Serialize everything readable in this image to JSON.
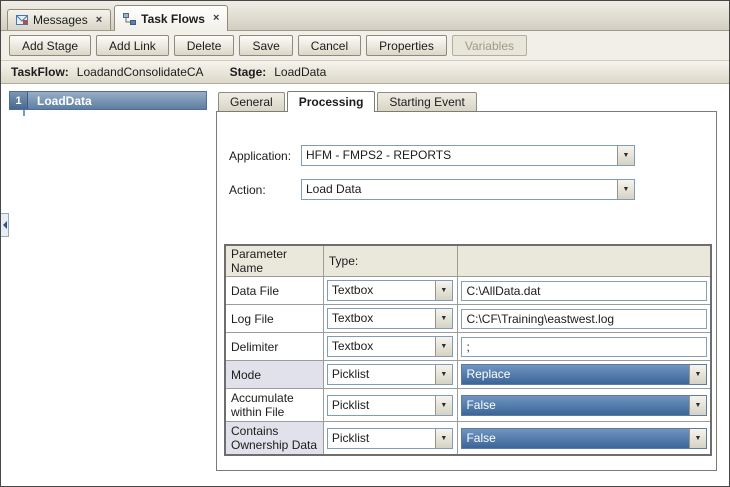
{
  "doc_tabs": [
    {
      "label": "Messages"
    },
    {
      "label": "Task Flows"
    }
  ],
  "icons": {
    "close": "×",
    "chevron_down": "▼"
  },
  "toolbar": {
    "buttons": [
      {
        "label": "Add Stage"
      },
      {
        "label": "Add Link"
      },
      {
        "label": "Delete"
      },
      {
        "label": "Save"
      },
      {
        "label": "Cancel"
      },
      {
        "label": "Properties"
      },
      {
        "label": "Variables",
        "disabled": true
      }
    ]
  },
  "info_bar": {
    "taskflow_label": "TaskFlow:",
    "taskflow_value": "LoadandConsolidateCA",
    "stage_label": "Stage:",
    "stage_value": "LoadData"
  },
  "stage": {
    "number": "1",
    "name": "LoadData"
  },
  "detail_tabs": [
    {
      "label": "General"
    },
    {
      "label": "Processing",
      "active": true
    },
    {
      "label": "Starting Event"
    }
  ],
  "form": {
    "application_label": "Application:",
    "application_value": "HFM - FMPS2 - REPORTS",
    "action_label": "Action:",
    "action_value": "Load Data"
  },
  "param_table": {
    "headers": [
      "Parameter Name",
      "Type:",
      ""
    ],
    "rows": [
      {
        "name": "Data File",
        "type": "Textbox",
        "value": "C:\\AllData.dat",
        "kind": "textbox",
        "shaded": false
      },
      {
        "name": "Log File",
        "type": "Textbox",
        "value": "C:\\CF\\Training\\eastwest.log",
        "kind": "textbox",
        "shaded": false
      },
      {
        "name": "Delimiter",
        "type": "Textbox",
        "value": ";",
        "kind": "textbox",
        "shaded": false
      },
      {
        "name": "Mode",
        "type": "Picklist",
        "value": "Replace",
        "kind": "picklist",
        "shaded": true
      },
      {
        "name": "Accumulate within File",
        "type": "Picklist",
        "value": "False",
        "kind": "picklist",
        "shaded": false
      },
      {
        "name": "Contains Ownership Data",
        "type": "Picklist",
        "value": "False",
        "kind": "picklist",
        "shaded": true
      }
    ]
  },
  "colors": {
    "stage_blue": "#5e7ea2",
    "picklist_blue": "#3c6598",
    "chrome_beige": "#d8d4c6"
  }
}
